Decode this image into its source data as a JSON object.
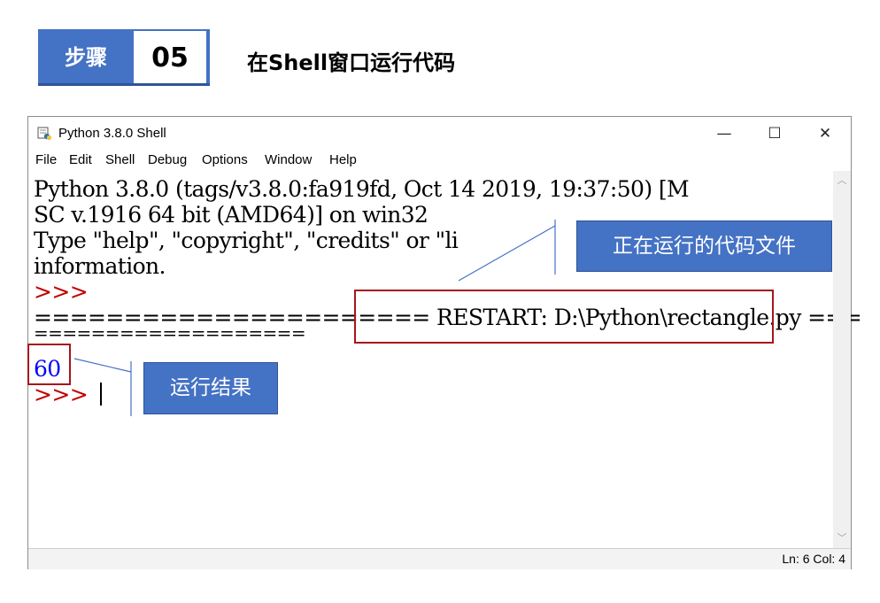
{
  "step": {
    "label": "步骤",
    "number": "05",
    "title": "在Shell窗口运行代码"
  },
  "window": {
    "title": "Python 3.8.0 Shell",
    "controls": {
      "minimize": "—",
      "maximize": "☐",
      "close": "✕"
    }
  },
  "menu": [
    "File",
    "Edit",
    "Shell",
    "Debug",
    "Options",
    "Window",
    "Help"
  ],
  "editor": {
    "line1": "Python 3.8.0 (tags/v3.8.0:fa919fd, Oct 14 2019, 19:37:50) [M",
    "line2": "SC v.1916 64 bit (AMD64)] on win32",
    "line3": "Type \"help\", \"copyright\", \"credits\" or \"li",
    "line4": "information.",
    "prompt": ">>>",
    "restart_pre": "====================== ",
    "restart_text": "RESTART: D:\\Python\\rectangle.py",
    "restart_post": " ===",
    "restart_cont": "===================",
    "output": "60"
  },
  "status": "Ln: 6  Col: 4",
  "annotations": {
    "file_callout": "正在运行的代码文件",
    "result_callout": "运行结果"
  },
  "colors": {
    "accent": "#4472c4",
    "highlight": "#a6161d",
    "prompt": "#c00000",
    "output": "#0000ff"
  }
}
